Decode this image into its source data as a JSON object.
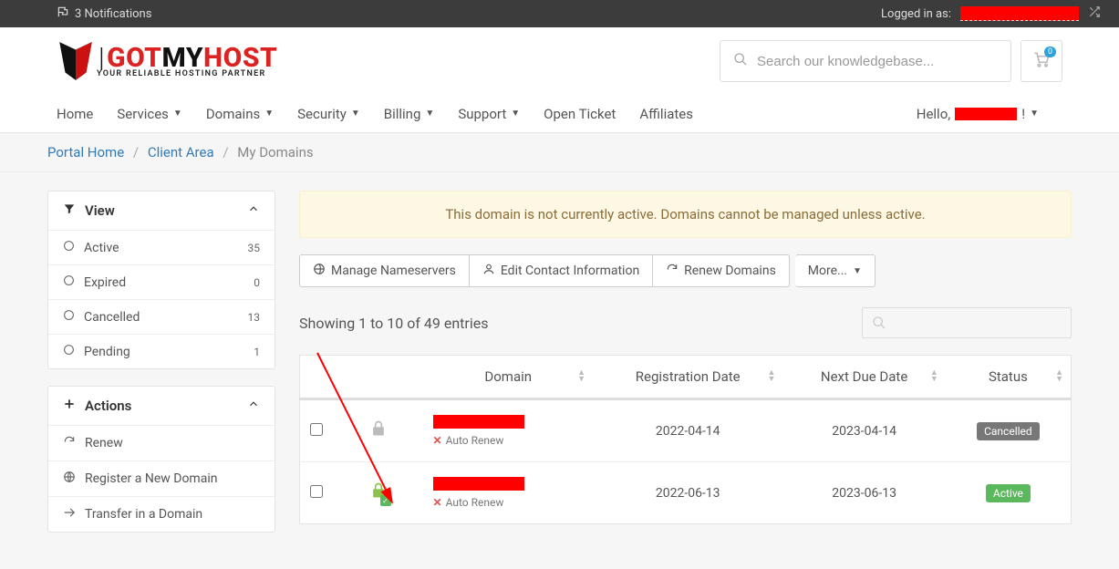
{
  "topbar": {
    "notifications": "3 Notifications",
    "logged_in_as": "Logged in as:"
  },
  "logo": {
    "line1_got": "GOT",
    "line1_my": "MY",
    "line1_host": "HOST",
    "line2": "YOUR RELIABLE HOSTING PARTNER"
  },
  "search": {
    "placeholder": "Search our knowledgebase..."
  },
  "cart": {
    "count": "0"
  },
  "nav": {
    "home": "Home",
    "services": "Services",
    "domains": "Domains",
    "security": "Security",
    "billing": "Billing",
    "support": "Support",
    "open_ticket": "Open Ticket",
    "affiliates": "Affiliates",
    "hello": "Hello,",
    "hello_tail": "!"
  },
  "breadcrumb": {
    "portal_home": "Portal Home",
    "client_area": "Client Area",
    "current": "My Domains"
  },
  "sidebar": {
    "view": {
      "title": "View",
      "items": [
        {
          "label": "Active",
          "count": "35"
        },
        {
          "label": "Expired",
          "count": "0"
        },
        {
          "label": "Cancelled",
          "count": "13"
        },
        {
          "label": "Pending",
          "count": "1"
        }
      ]
    },
    "actions": {
      "title": "Actions",
      "items": [
        {
          "label": "Renew"
        },
        {
          "label": "Register a New Domain"
        },
        {
          "label": "Transfer in a Domain"
        }
      ]
    }
  },
  "alert": "This domain is not currently active. Domains cannot be managed unless active.",
  "toolbar": {
    "manage_ns": "Manage Nameservers",
    "edit_contact": "Edit Contact Information",
    "renew_domains": "Renew Domains",
    "more": "More..."
  },
  "table": {
    "entries": "Showing 1 to 10 of 49 entries",
    "headers": {
      "domain": "Domain",
      "reg_date": "Registration Date",
      "due_date": "Next Due Date",
      "status": "Status"
    },
    "auto_renew": "Auto Renew",
    "rows": [
      {
        "reg": "2022-04-14",
        "due": "2023-04-14",
        "status": "Cancelled",
        "status_class": "stat-cancelled",
        "locked": false
      },
      {
        "reg": "2022-06-13",
        "due": "2023-06-13",
        "status": "Active",
        "status_class": "stat-active",
        "locked": true
      }
    ]
  }
}
